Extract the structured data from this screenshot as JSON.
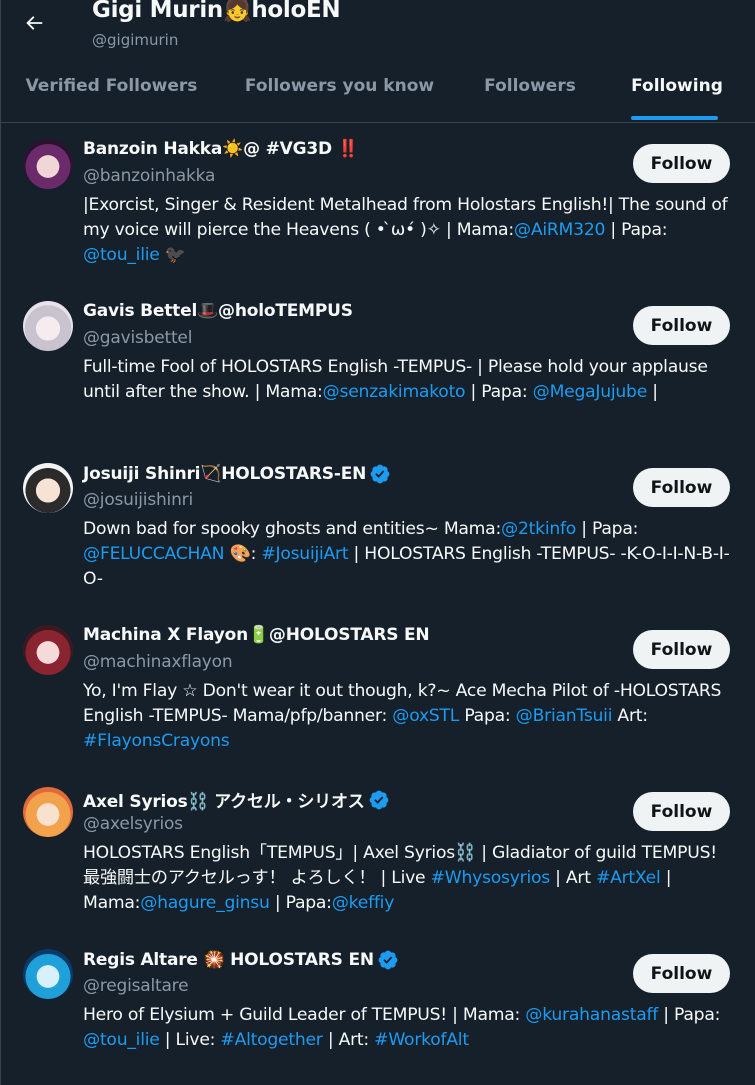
{
  "header": {
    "title": "Gigi Murin👧holoEN",
    "handle": "@gigimurin"
  },
  "tabs": [
    {
      "label": "Verified Followers",
      "active": false
    },
    {
      "label": "Followers you know",
      "active": false
    },
    {
      "label": "Followers",
      "active": false
    },
    {
      "label": "Following",
      "active": true
    }
  ],
  "colors": {
    "background": "#15202b",
    "accent": "#1d9bf0",
    "muted": "#8b98a5",
    "text": "#f7f9f9",
    "button_bg": "#eff3f4"
  },
  "follow_label": "Follow",
  "users": [
    {
      "name": "Banzoin Hakka☀️@ #VG3D ‼️",
      "handle": "@banzoinhakka",
      "verified": false,
      "bio": [
        {
          "t": "|Exorcist, Singer & Resident Metalhead from Holostars English!| The sound of my voice will pierce the Heavens ( • ̀ω•́ )✧ | Mama:"
        },
        {
          "t": "@AiRM320",
          "link": true
        },
        {
          "t": " | Papa: "
        },
        {
          "t": "@tou_ilie",
          "link": true
        },
        {
          "t": " 🐦‍⬛"
        }
      ]
    },
    {
      "name": "Gavis Bettel🎩@holoTEMPUS",
      "handle": "@gavisbettel",
      "verified": false,
      "bio": [
        {
          "t": "Full-time Fool of HOLOSTARS English -TEMPUS- | Please hold your applause until after the show. | Mama:"
        },
        {
          "t": "@senzakimakoto",
          "link": true
        },
        {
          "t": " | Papa: "
        },
        {
          "t": "@MegaJujube",
          "link": true
        },
        {
          "t": " |"
        }
      ]
    },
    {
      "name": "Josuiji Shinri🏹HOLOSTARS-EN",
      "handle": "@josuijishinri",
      "verified": true,
      "bio": [
        {
          "t": "Down bad for spooky ghosts and entities~ Mama:"
        },
        {
          "t": "@2tkinfo",
          "link": true
        },
        {
          "t": " | Papa: "
        },
        {
          "t": "@FELUCCACHAN",
          "link": true
        },
        {
          "t": " 🎨: "
        },
        {
          "t": "#JosuijiArt",
          "link": true
        },
        {
          "t": " | HOLOSTARS English -TEMPUS- -K-O-I-I-N-B-I-O-"
        }
      ]
    },
    {
      "name": "Machina X Flayon🔋@HOLOSTARS EN",
      "handle": "@machinaxflayon",
      "verified": false,
      "bio": [
        {
          "t": "Yo, I'm Flay ☆ Don't wear it out though, k?~ Ace Mecha Pilot of -HOLOSTARS English -TEMPUS- Mama/pfp/banner: "
        },
        {
          "t": "@oxSTL",
          "link": true
        },
        {
          "t": " Papa: "
        },
        {
          "t": "@BrianTsuii",
          "link": true
        },
        {
          "t": " Art: "
        },
        {
          "t": "#FlayonsCrayons",
          "link": true
        }
      ]
    },
    {
      "name": "Axel Syrios⛓️ アクセル・シリオス",
      "handle": "@axelsyrios",
      "verified": true,
      "bio": [
        {
          "t": "HOLOSTARS English「TEMPUS」| Axel Syrios⛓️ | Gladiator of guild TEMPUS! 最強闘士のアクセルっす！ よろしく！ | Live "
        },
        {
          "t": "#Whysosyrios",
          "link": true
        },
        {
          "t": " | Art "
        },
        {
          "t": "#ArtXel",
          "link": true
        },
        {
          "t": " | Mama:"
        },
        {
          "t": "@hagure_ginsu",
          "link": true
        },
        {
          "t": " | Papa:"
        },
        {
          "t": "@keffiy",
          "link": true
        }
      ]
    },
    {
      "name": "Regis Altare 🎇 HOLOSTARS EN",
      "handle": "@regisaltare",
      "verified": true,
      "bio": [
        {
          "t": "Hero of Elysium + Guild Leader of TEMPUS! | Mama: "
        },
        {
          "t": "@kurahanastaff",
          "link": true
        },
        {
          "t": " | Papa: "
        },
        {
          "t": "@tou_ilie",
          "link": true
        },
        {
          "t": " | Live: "
        },
        {
          "t": "#Altogether",
          "link": true
        },
        {
          "t": " | Art: "
        },
        {
          "t": "#WorkofAlt",
          "link": true
        }
      ]
    }
  ]
}
